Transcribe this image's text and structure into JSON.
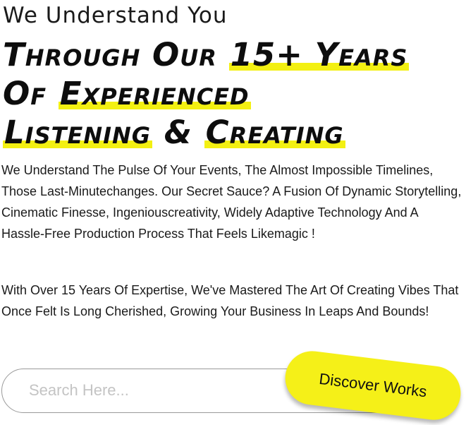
{
  "hero": {
    "eyebrow": "We Understand You",
    "headline": {
      "line1_plain": "Through Our ",
      "line1_highlight": "15+ Years",
      "line2_plain": "Of ",
      "line2_highlight": "Experienced",
      "line3_highlight_a": "Listening",
      "line3_plain": " & ",
      "line3_highlight_b": "Creating"
    },
    "highlight_color": "#f3f012"
  },
  "body": {
    "paragraph1": "We Understand The Pulse Of Your Events, The Almost Impossible Timelines, Those Last-Minutechanges. Our Secret Sauce? A Fusion Of Dynamic Storytelling, Cinematic Finesse, Ingeniouscreativity, Widely Adaptive Technology And A Hassle-Free Production Process That Feels Likemagic !",
    "paragraph2": "With Over 15 Years Of Expertise, We've Mastered The Art Of Creating Vibes That Once Felt Is Long Cherished, Growing Your Business In Leaps And Bounds!"
  },
  "search": {
    "placeholder": "Search Here...",
    "value": ""
  },
  "cta": {
    "label": "Discover Works",
    "color": "#f5f018"
  }
}
